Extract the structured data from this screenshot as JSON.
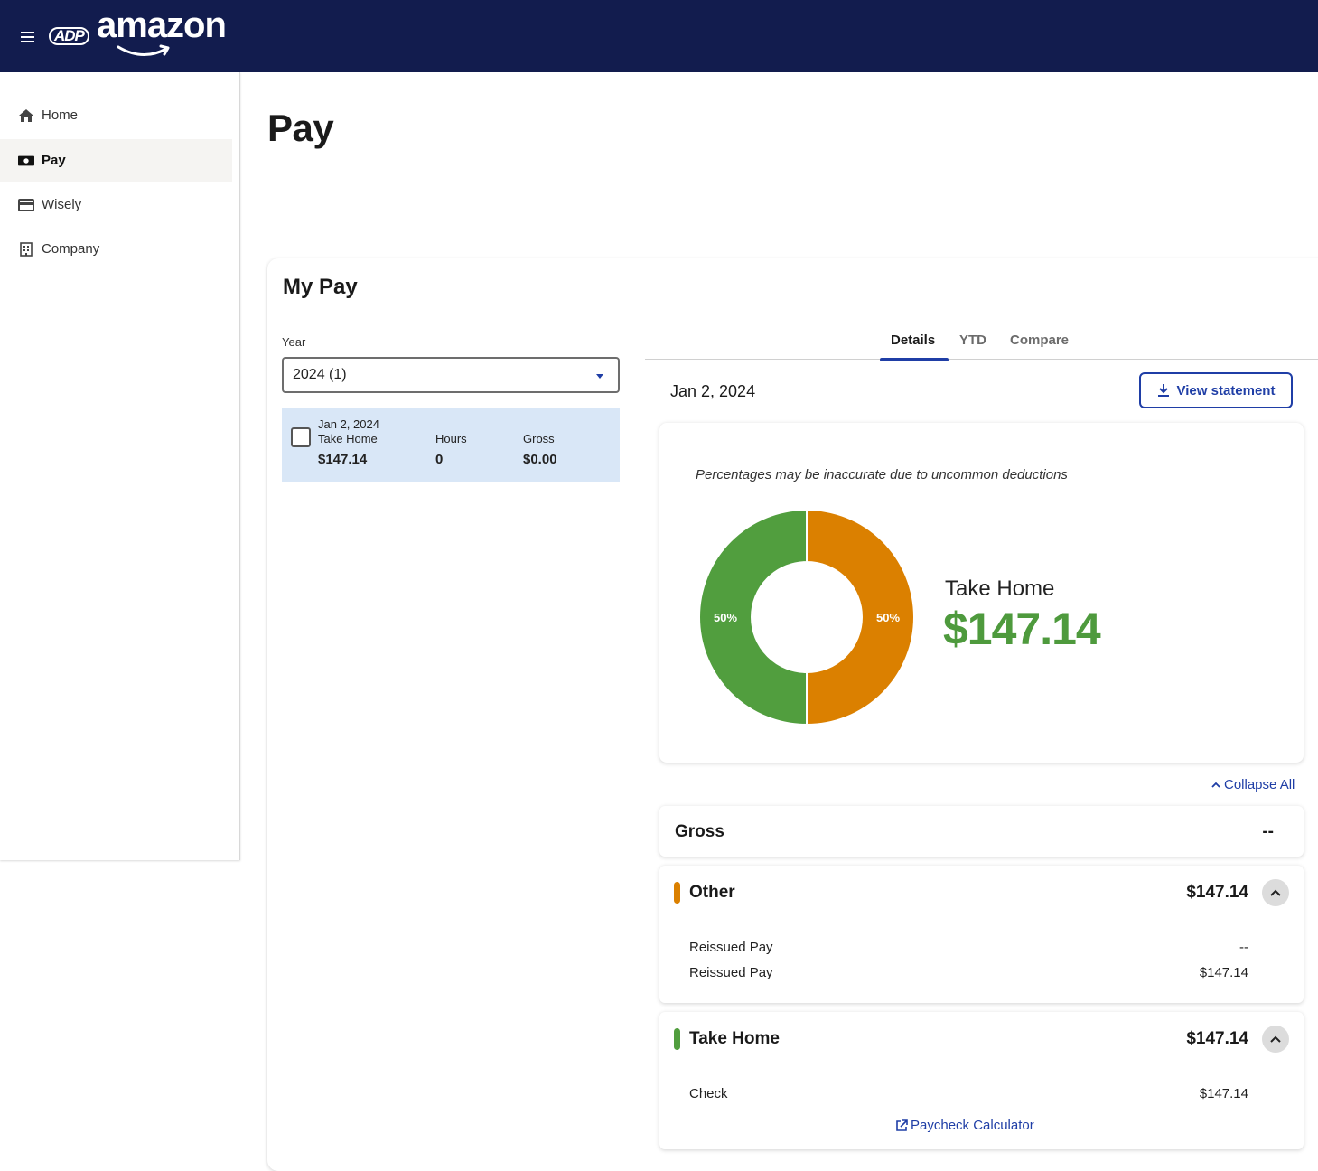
{
  "header": {
    "menu_icon": "hamburger-icon",
    "adp_logo_text": "ADP",
    "brand_logo_text": "amazon"
  },
  "sidebar": {
    "items": [
      {
        "label": "Home",
        "icon": "home-icon",
        "active": false
      },
      {
        "label": "Pay",
        "icon": "money-icon",
        "active": true
      },
      {
        "label": "Wisely",
        "icon": "card-icon",
        "active": false
      },
      {
        "label": "Company",
        "icon": "building-icon",
        "active": false
      }
    ]
  },
  "page": {
    "title": "Pay"
  },
  "my_pay": {
    "title": "My Pay",
    "year_label": "Year",
    "year_value": "2024 (1)",
    "statement": {
      "date": "Jan 2, 2024",
      "take_home_label": "Take Home",
      "take_home_value": "$147.14",
      "hours_label": "Hours",
      "hours_value": "0",
      "gross_label": "Gross",
      "gross_value": "$0.00"
    }
  },
  "details": {
    "tabs": [
      {
        "label": "Details",
        "active": true
      },
      {
        "label": "YTD",
        "active": false
      },
      {
        "label": "Compare",
        "active": false
      }
    ],
    "pay_date": "Jan 2, 2024",
    "view_statement_label": "View statement",
    "disclaimer": "Percentages may be inaccurate due to uncommon deductions",
    "take_home_label": "Take Home",
    "take_home_amount": "$147.14",
    "collapse_all_label": "Collapse All",
    "paycheck_calculator_label": "Paycheck Calculator"
  },
  "chart_data": {
    "type": "pie",
    "donut": true,
    "categories": [
      "Other",
      "Take Home"
    ],
    "values": [
      50,
      50
    ],
    "value_labels": [
      "50%",
      "50%"
    ],
    "colors": [
      "#db8000",
      "#519e3e"
    ]
  },
  "breakdown": {
    "gross": {
      "label": "Gross",
      "amount": "--"
    },
    "other": {
      "label": "Other",
      "amount": "$147.14",
      "color": "#db8000",
      "lines": [
        {
          "label": "Reissued Pay",
          "amount": "--"
        },
        {
          "label": "Reissued Pay",
          "amount": "$147.14"
        }
      ]
    },
    "take_home": {
      "label": "Take Home",
      "amount": "$147.14",
      "color": "#519e3e",
      "lines": [
        {
          "label": "Check",
          "amount": "$147.14"
        }
      ]
    }
  }
}
